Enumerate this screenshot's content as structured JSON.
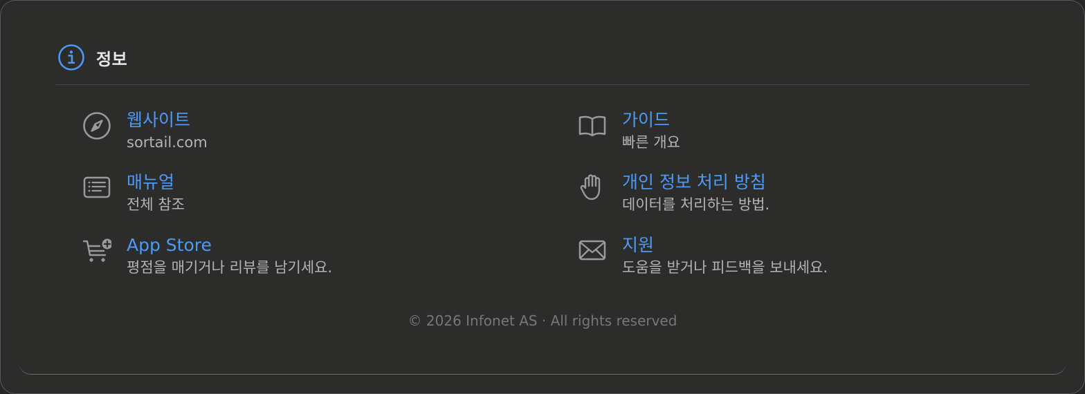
{
  "section": {
    "title": "정보"
  },
  "links": [
    {
      "icon": "compass-icon",
      "label": "웹사이트",
      "sub": "sortail.com"
    },
    {
      "icon": "book-icon",
      "label": "가이드",
      "sub": "빠른 개요"
    },
    {
      "icon": "document-list-icon",
      "label": "매뉴얼",
      "sub": "전체 참조"
    },
    {
      "icon": "hand-raised-icon",
      "label": "개인 정보 처리 방침",
      "sub": "데이터를 처리하는 방법."
    },
    {
      "icon": "cart-plus-icon",
      "label": "App Store",
      "sub": "평점을 매기거나 리뷰를 남기세요."
    },
    {
      "icon": "envelope-icon",
      "label": "지원",
      "sub": "도움을 받거나 피드백을 보내세요."
    }
  ],
  "footer": {
    "text": "© 2026 Infonet AS · All rights reserved"
  },
  "colors": {
    "accent": "#4c9af5",
    "background": "#2c2c2b",
    "text_primary": "#e6e6e6",
    "text_secondary": "#b4b4b4",
    "icon_gray": "#9a9a9a"
  }
}
